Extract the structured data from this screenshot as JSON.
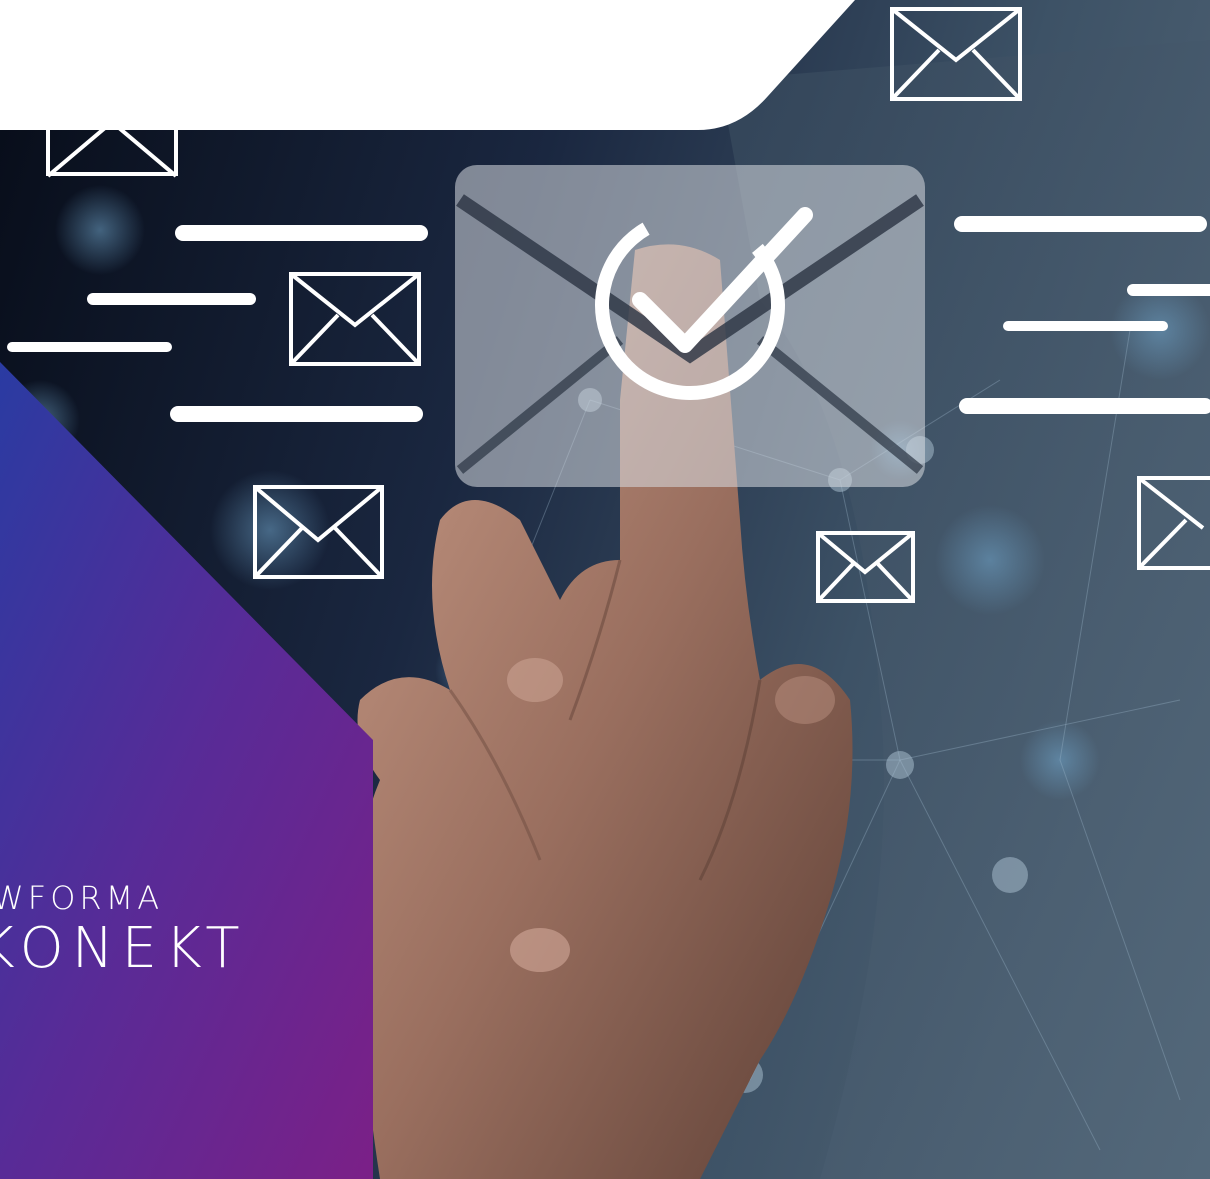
{
  "brand": {
    "line1": "NEWFORMA",
    "line2": "KONEKT",
    "gradient_colors": [
      "#2c3fa0",
      "#5b2a96",
      "#7a2086"
    ]
  },
  "colors": {
    "header_panel": "#ffffff",
    "background_dark": "#0c1422",
    "background_mid": "#3f5366",
    "icon_stroke": "#ffffff"
  },
  "icons": [
    "envelope-check-icon",
    "envelope-icon",
    "checkmark-icon"
  ]
}
